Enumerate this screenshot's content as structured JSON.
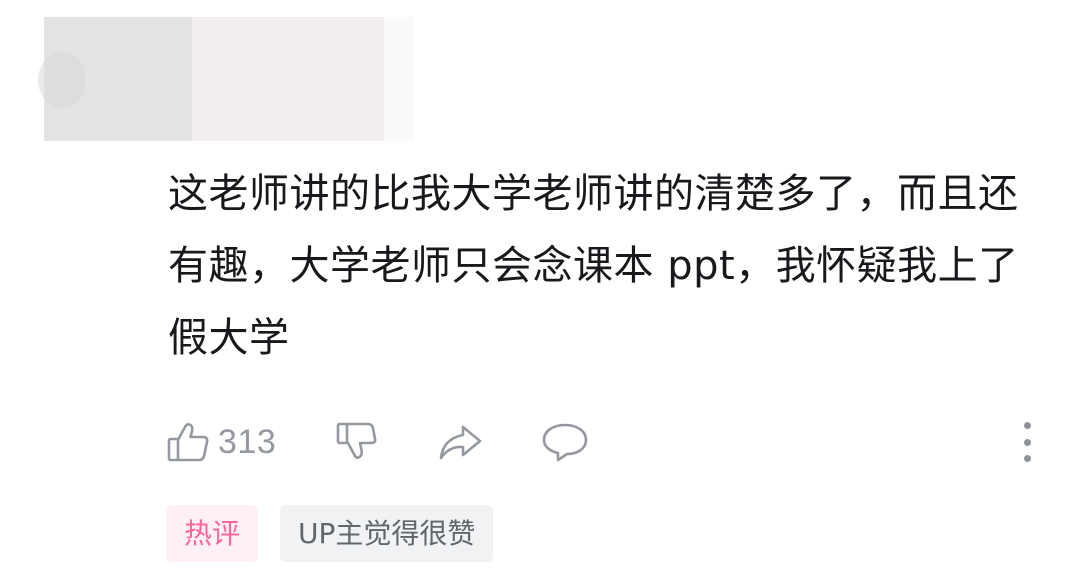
{
  "comment": {
    "text": "这老师讲的比我大学老师讲的清楚多了，而且还有趣，大学老师只会念课本 ppt，我怀疑我上了假大学"
  },
  "actions": {
    "like_count": "313",
    "like_icon": "thumbs-up-icon",
    "dislike_icon": "thumbs-down-icon",
    "share_icon": "share-arrow-icon",
    "reply_icon": "reply-bubble-icon",
    "more_icon": "more-vertical-icon"
  },
  "tags": {
    "hot": "热评",
    "up_liked": "UP主觉得很赞"
  },
  "colors": {
    "text": "#18191c",
    "icon": "#9499a0",
    "hot_tag_text": "#ff6699",
    "hot_tag_bg": "#fff0f4",
    "up_tag_text": "#61666d",
    "up_tag_bg": "#f1f2f3"
  }
}
